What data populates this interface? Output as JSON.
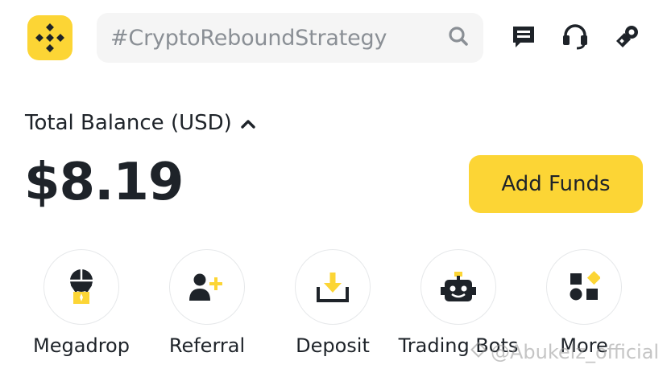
{
  "header": {
    "logo_icon": "binance-logo-icon",
    "search": {
      "value": "#CryptoReboundStrategy",
      "icon": "search-icon"
    },
    "actions": [
      {
        "name": "messages-icon"
      },
      {
        "name": "support-icon"
      },
      {
        "name": "referral-reward-icon"
      }
    ]
  },
  "balance": {
    "label": "Total Balance (USD)",
    "toggle_icon": "chevron-up-icon",
    "value": "$8.19",
    "add_funds_label": "Add Funds"
  },
  "shortcuts": [
    {
      "label": "Megadrop",
      "icon": "megadrop-icon"
    },
    {
      "label": "Referral",
      "icon": "referral-icon"
    },
    {
      "label": "Deposit",
      "icon": "deposit-icon"
    },
    {
      "label": "Trading Bots",
      "icon": "trading-bots-icon"
    },
    {
      "label": "More",
      "icon": "more-icon"
    }
  ],
  "watermark": "@Abukelz_official",
  "colors": {
    "brand": "#fcd535",
    "text": "#1e2329",
    "muted": "#8a8f95",
    "bg_field": "#f5f5f5"
  }
}
